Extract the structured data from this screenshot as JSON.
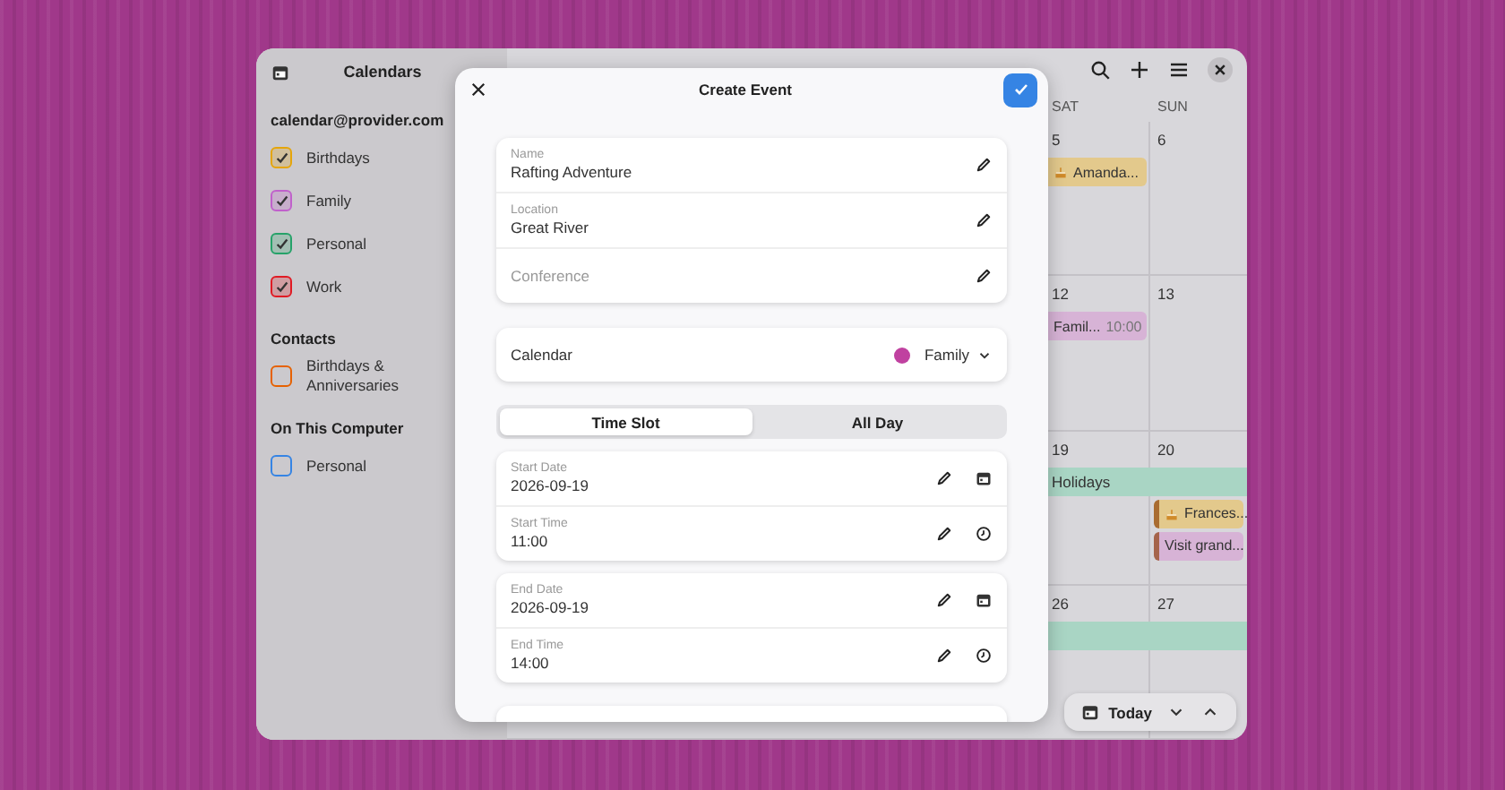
{
  "sidebar": {
    "title": "Calendars",
    "groups": [
      {
        "title": "calendar@provider.com",
        "calendars": [
          {
            "name": "Birthdays",
            "color": "#e5a50a",
            "checked": true
          },
          {
            "name": "Family",
            "color": "#c061cb",
            "checked": true
          },
          {
            "name": "Personal",
            "color": "#26a269",
            "checked": true
          },
          {
            "name": "Work",
            "color": "#e01b24",
            "checked": true
          }
        ]
      },
      {
        "title": "Contacts",
        "calendars": [
          {
            "name": "Birthdays & Anniversaries",
            "color": "#e66100",
            "checked": false
          }
        ]
      },
      {
        "title": "On This Computer",
        "calendars": [
          {
            "name": "Personal",
            "color": "#3584e4",
            "checked": false
          }
        ]
      }
    ]
  },
  "calendar": {
    "columns": [
      "SAT",
      "SUN"
    ],
    "weeks": [
      {
        "days": [
          {
            "number": "5",
            "events": [
              {
                "kind": "birthday",
                "title": "Amanda...",
                "color": "#e3c98c",
                "highlighted": false
              }
            ]
          },
          {
            "number": "6"
          }
        ]
      },
      {
        "days": [
          {
            "number": "12",
            "events": [
              {
                "kind": "timed",
                "title": "Famil...",
                "time": "10:00",
                "color": "#d7b3d6",
                "highlighted": false
              }
            ]
          },
          {
            "number": "13"
          }
        ]
      },
      {
        "banners": [
          {
            "title": "Holidays",
            "color": "#a9d5c4"
          }
        ],
        "days": [
          {
            "number": "19"
          },
          {
            "number": "20",
            "events": [
              {
                "kind": "birthday",
                "title": "Frances...",
                "color": "#e3c98c",
                "highlighted": true
              },
              {
                "kind": "allday",
                "title": "Visit grand...",
                "color": "#d7b3d6",
                "highlighted": true
              }
            ]
          }
        ]
      },
      {
        "banners": [
          {
            "color": "#a9d5c4"
          }
        ],
        "days": [
          {
            "number": "26"
          },
          {
            "number": "27"
          }
        ]
      }
    ],
    "toolbar": {
      "today": "Today"
    }
  },
  "dialog": {
    "title": "Create Event",
    "details": [
      {
        "label": "Name",
        "value": "Rafting Adventure"
      },
      {
        "label": "Location",
        "value": "Great River"
      },
      {
        "placeholder": "Conference"
      }
    ],
    "calendar": {
      "label": "Calendar",
      "value": "Family",
      "color": "#c041a0"
    },
    "modes": [
      {
        "label": "Time Slot",
        "selected": true
      },
      {
        "label": "All Day",
        "selected": false
      }
    ],
    "slots": [
      [
        {
          "label": "Start Date",
          "value": "2026-09-19",
          "kind": "date"
        },
        {
          "label": "Start Time",
          "value": "11:00",
          "kind": "time"
        }
      ],
      [
        {
          "label": "End Date",
          "value": "2026-09-19",
          "kind": "date"
        },
        {
          "label": "End Time",
          "value": "14:00",
          "kind": "time"
        }
      ]
    ]
  }
}
